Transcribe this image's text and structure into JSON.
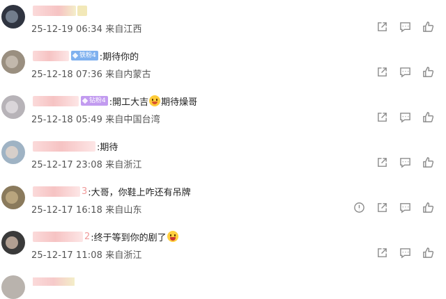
{
  "comments": [
    {
      "name_tail": "",
      "badge": "",
      "text": "",
      "emoji": "",
      "text2": "",
      "meta": "25-12-19 06:34 来自江西",
      "report": false
    },
    {
      "name_tail": "",
      "badge": "铁粉4",
      "text": ":期待你的",
      "emoji": "",
      "text2": "",
      "meta": "25-12-18 07:36 来自内蒙古",
      "report": false
    },
    {
      "name_tail": "",
      "badge": "钻粉4",
      "text": ":開工大吉",
      "emoji": "face",
      "text2": "期待燥哥",
      "meta": "25-12-18 05:49 来自中国台湾",
      "report": false
    },
    {
      "name_tail": "",
      "badge": "",
      "text": ":期待",
      "emoji": "",
      "text2": "",
      "meta": "25-12-17 23:08 来自浙江",
      "report": false
    },
    {
      "name_tail": "3",
      "badge": "",
      "text": ":大哥，你鞋上咋还有吊牌",
      "emoji": "",
      "text2": "",
      "meta": "25-12-17 16:18 来自山东",
      "report": true
    },
    {
      "name_tail": "2",
      "badge": "",
      "text": ":终于等到你的剧了",
      "emoji": "cry",
      "text2": "",
      "meta": "25-12-17 11:08 来自浙江",
      "report": false
    }
  ],
  "icons": {
    "share": "share-icon",
    "comment": "comment-icon",
    "like": "thumbs-up-icon",
    "report": "exclamation-circle-icon"
  },
  "colors": {
    "meta_text": "#555555",
    "badge_fan": "#7fb1ef",
    "badge_diamond": "#c29bf0",
    "icon_stroke": "#8c8c8c"
  }
}
